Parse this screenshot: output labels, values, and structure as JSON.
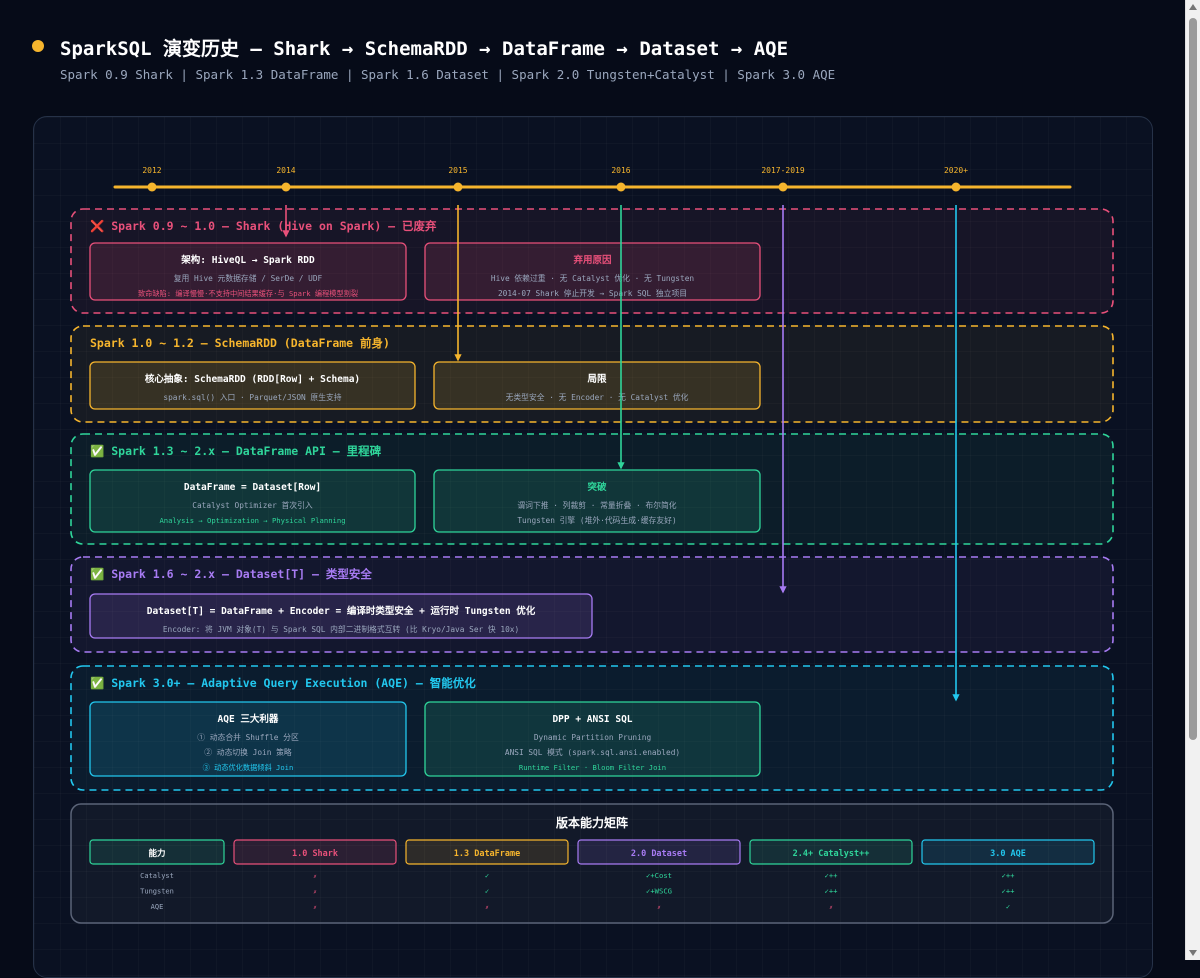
{
  "header": {
    "title": "SparkSQL 演变历史 — Shark → SchemaRDD → DataFrame → Dataset → AQE",
    "subtitle": "Spark 0.9 Shark | Spark 1.3 DataFrame | Spark 1.6 Dataset | Spark 2.0 Tungsten+Catalyst | Spark 3.0 AQE"
  },
  "colors": {
    "red": "#e8507a",
    "yellow": "#f6b52d",
    "green": "#2fd59a",
    "purple": "#a77bf3",
    "cyan": "#22c7ee",
    "timeline": "#f6b52d"
  },
  "timeline": [
    {
      "label": "2012",
      "color": "yellow"
    },
    {
      "label": "2014",
      "color": "red"
    },
    {
      "label": "2015",
      "color": "yellow"
    },
    {
      "label": "2016",
      "color": "green"
    },
    {
      "label": "2017-2019",
      "color": "purple"
    },
    {
      "label": "2020+",
      "color": "cyan"
    }
  ],
  "sections": [
    {
      "title": "❌ Spark 0.9 ~ 1.0 — Shark (Hive on Spark) — 已废弃",
      "color": "red",
      "cards": [
        {
          "title": "架构: HiveQL → Spark RDD",
          "lines": [
            "复用 Hive 元数据存储 / SerDe / UDF",
            "致命缺陷: 编译慢慢·不支持中间结果缓存·与 Spark 编程模型割裂"
          ],
          "title_color": "white",
          "last_colored": true
        },
        {
          "title": "弃用原因",
          "lines": [
            "Hive 依赖过重 · 无 Catalyst 优化 · 无 Tungsten",
            "2014-07 Shark 停止开发 → Spark SQL 独立项目"
          ],
          "title_color": "accent",
          "last_colored": false
        }
      ]
    },
    {
      "title": "Spark 1.0 ~ 1.2 — SchemaRDD (DataFrame 前身)",
      "color": "yellow",
      "cards": [
        {
          "title": "核心抽象: SchemaRDD (RDD[Row] + Schema)",
          "lines": [
            "spark.sql() 入口 · Parquet/JSON 原生支持"
          ],
          "title_color": "white",
          "last_colored": false
        },
        {
          "title": "局限",
          "lines": [
            "无类型安全 · 无 Encoder · 无 Catalyst 优化"
          ],
          "title_color": "white",
          "last_colored": false
        }
      ]
    },
    {
      "title": "✅ Spark 1.3 ~ 2.x — DataFrame API — 里程碑",
      "color": "green",
      "cards": [
        {
          "title": "DataFrame = Dataset[Row]",
          "lines": [
            "Catalyst Optimizer 首次引入",
            "Analysis → Optimization → Physical Planning"
          ],
          "title_color": "white",
          "last_colored": true
        },
        {
          "title": "突破",
          "lines": [
            "谓词下推 · 列裁剪 · 常量折叠 · 布尔简化",
            "Tungsten 引擎 (堆外·代码生成·缓存友好)"
          ],
          "title_color": "accent",
          "last_colored": false
        }
      ]
    },
    {
      "title": "✅ Spark 1.6 ~ 2.x — Dataset[T] — 类型安全",
      "color": "purple",
      "cards": [
        {
          "title": "Dataset[T] = DataFrame + Encoder = 编译时类型安全 + 运行时 Tungsten 优化",
          "lines": [
            "Encoder: 将 JVM 对象(T) 与 Spark SQL 内部二进制格式互转 (比 Kryo/Java Ser 快 10x)"
          ],
          "title_color": "white",
          "last_colored": false
        }
      ]
    },
    {
      "title": "✅ Spark 3.0+ — Adaptive Query Execution (AQE) — 智能优化",
      "color": "cyan",
      "cards": [
        {
          "title": "AQE 三大利器",
          "lines": [
            "① 动态合并 Shuffle 分区",
            "② 动态切换 Join 策略",
            "③ 动态优化数据倾斜 Join"
          ],
          "title_color": "white",
          "last_colored": true
        },
        {
          "title": "DPP + ANSI SQL",
          "lines": [
            "Dynamic Partition Pruning",
            "ANSI SQL 模式 (spark.sql.ansi.enabled)",
            "Runtime Filter · Bloom Filter Join"
          ],
          "title_color": "white",
          "last_colored": true,
          "border": "green"
        }
      ]
    }
  ],
  "matrix": {
    "title": "版本能力矩阵",
    "headers": [
      {
        "label": "能力",
        "color": "green"
      },
      {
        "label": "1.0 Shark",
        "color": "red"
      },
      {
        "label": "1.3 DataFrame",
        "color": "yellow"
      },
      {
        "label": "2.0 Dataset",
        "color": "purple"
      },
      {
        "label": "2.4+ Catalyst++",
        "color": "green"
      },
      {
        "label": "3.0 AQE",
        "color": "cyan"
      }
    ],
    "rows": [
      {
        "name": "Catalyst",
        "cells": [
          "✗",
          "✓",
          "✓+Cost",
          "✓++",
          "✓++"
        ]
      },
      {
        "name": "Tungsten",
        "cells": [
          "✗",
          "✓",
          "✓+WSCG",
          "✓++",
          "✓++"
        ]
      },
      {
        "name": "AQE",
        "cells": [
          "✗",
          "✗",
          "✗",
          "✗",
          "✓"
        ]
      }
    ]
  }
}
